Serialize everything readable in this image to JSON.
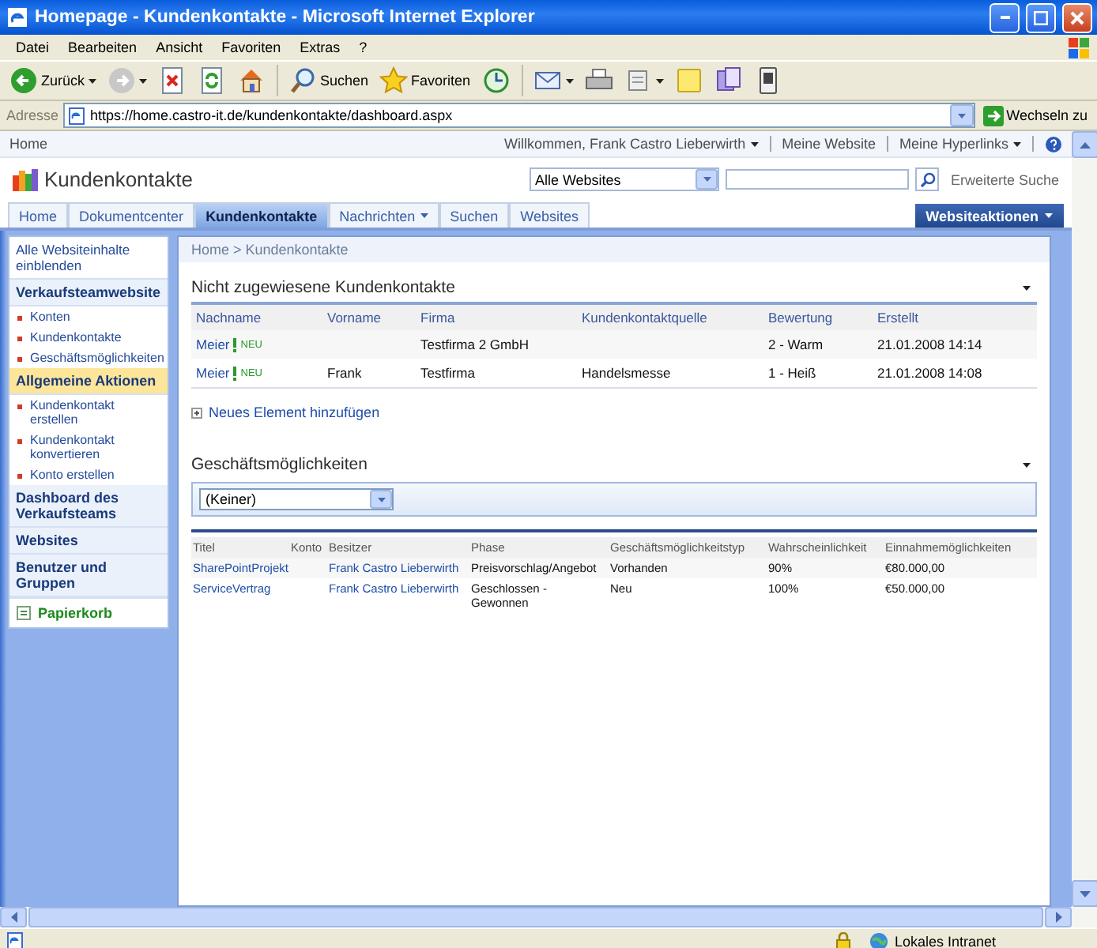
{
  "window": {
    "title": "Homepage - Kundenkontakte - Microsoft Internet Explorer"
  },
  "menu": [
    "Datei",
    "Bearbeiten",
    "Ansicht",
    "Favoriten",
    "Extras",
    "?"
  ],
  "toolbar": [
    {
      "kind": "back",
      "label": "Zurück",
      "dropdown": true
    },
    {
      "kind": "forward",
      "dropdown": true
    },
    {
      "kind": "stop"
    },
    {
      "kind": "refresh"
    },
    {
      "kind": "home"
    },
    {
      "kind": "search",
      "label": "Suchen"
    },
    {
      "kind": "favorites",
      "label": "Favoriten"
    },
    {
      "kind": "history"
    },
    {
      "kind": "mail",
      "dropdown": true
    },
    {
      "kind": "print"
    },
    {
      "kind": "edit",
      "dropdown": true
    },
    {
      "kind": "notes"
    },
    {
      "kind": "messenger"
    },
    {
      "kind": "research"
    }
  ],
  "address": {
    "label": "Adresse",
    "url": "https://home.castro-it.de/kundenkontakte/dashboard.aspx",
    "go": "Wechseln zu"
  },
  "site": {
    "top_link": "Home",
    "welcome": "Willkommen, Frank Castro Lieberwirth",
    "links": [
      {
        "label": "Meine Website",
        "dropdown": false
      },
      {
        "label": "Meine Hyperlinks",
        "dropdown": true
      }
    ],
    "title": "Kundenkontakte",
    "search_scope": "Alle Websites",
    "advanced_search": "Erweiterte Suche"
  },
  "tabs": [
    {
      "label": "Home",
      "selected": false,
      "dropdown": false
    },
    {
      "label": "Dokumentcenter",
      "selected": false,
      "dropdown": false
    },
    {
      "label": "Kundenkontakte",
      "selected": true,
      "dropdown": false
    },
    {
      "label": "Nachrichten",
      "selected": false,
      "dropdown": true
    },
    {
      "label": "Suchen",
      "selected": false,
      "dropdown": false
    },
    {
      "label": "Websites",
      "selected": false,
      "dropdown": false
    }
  ],
  "site_actions": "Websiteaktionen",
  "nav": [
    {
      "kind": "link",
      "label": "Alle Websiteinhalte einblenden"
    },
    {
      "kind": "header",
      "label": "Verkaufsteamwebsite",
      "selected": false
    },
    {
      "kind": "item",
      "label": "Konten"
    },
    {
      "kind": "item",
      "label": "Kundenkontakte"
    },
    {
      "kind": "item",
      "label": "Geschäftsmöglichkeiten"
    },
    {
      "kind": "header",
      "label": "Allgemeine Aktionen",
      "selected": true
    },
    {
      "kind": "item",
      "label": "Kundenkontakt erstellen"
    },
    {
      "kind": "item",
      "label": "Kundenkontakt konvertieren"
    },
    {
      "kind": "item",
      "label": "Konto erstellen"
    },
    {
      "kind": "header",
      "label": "Dashboard des Verkaufsteams",
      "selected": false
    },
    {
      "kind": "header",
      "label": "Websites",
      "selected": false
    },
    {
      "kind": "header",
      "label": "Benutzer und Gruppen",
      "selected": false
    },
    {
      "kind": "recycle",
      "label": "Papierkorb"
    }
  ],
  "breadcrumb": "Home > Kundenkontakte",
  "contacts": {
    "title": "Nicht zugewiesene Kundenkontakte",
    "columns": [
      "Nachname",
      "Vorname",
      "Firma",
      "Kundenkontaktquelle",
      "Bewertung",
      "Erstellt"
    ],
    "rows": [
      {
        "badge": "NEU",
        "cells": [
          "Meier",
          null,
          "Testfirma 2 GmbH",
          null,
          "2 - Warm",
          "21.01.2008 14:14"
        ]
      },
      {
        "badge": "NEU",
        "cells": [
          "Meier",
          "Frank",
          "Testfirma",
          "Handelsmesse",
          "1 - Heiß",
          "21.01.2008 14:08"
        ]
      }
    ],
    "add": "Neues Element hinzufügen"
  },
  "opportunities": {
    "title": "Geschäftsmöglichkeiten",
    "view": "(Keiner)",
    "columns": [
      {
        "label": "Titel",
        "kind": "link"
      },
      {
        "label": "Konto",
        "kind": "text"
      },
      {
        "label": "Besitzer",
        "kind": "link"
      },
      {
        "label": "Phase",
        "kind": "text"
      },
      {
        "label": "Geschäftsmöglichkeitstyp",
        "kind": "text"
      },
      {
        "label": "Wahrscheinlichkeit",
        "kind": "text"
      },
      {
        "label": "Einnahmemöglichkeiten",
        "kind": "text"
      }
    ],
    "rows": [
      {
        "cells": [
          "SharePointProjekt",
          null,
          "Frank Castro Lieberwirth",
          "Preisvorschlag/Angebot",
          "Vorhanden",
          "90%",
          "€80.000,00"
        ]
      },
      {
        "cells": [
          "ServiceVertrag",
          null,
          "Frank Castro Lieberwirth",
          "Geschlossen - Gewonnen",
          "Neu",
          "100%",
          "€50.000,00"
        ]
      }
    ]
  },
  "status": {
    "zone": "Lokales Intranet"
  }
}
